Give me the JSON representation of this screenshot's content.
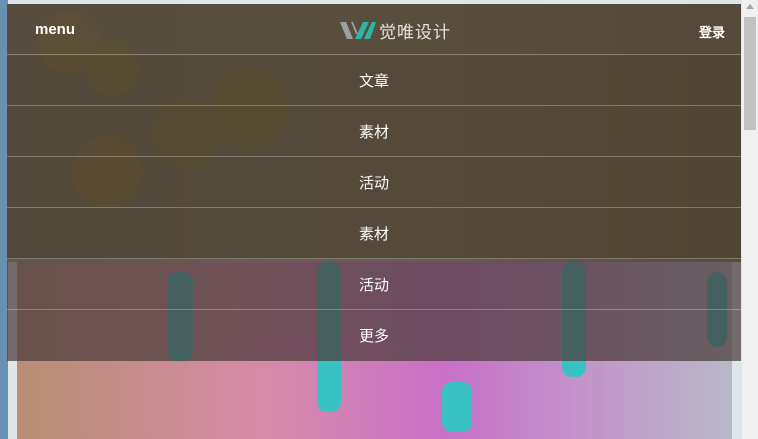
{
  "header": {
    "menu_label": "menu",
    "logo_text": "觉唯设计",
    "login_label": "登录"
  },
  "menu": {
    "items": [
      {
        "label": "文章"
      },
      {
        "label": "素材"
      },
      {
        "label": "活动"
      },
      {
        "label": "素材"
      },
      {
        "label": "活动"
      },
      {
        "label": "更多"
      }
    ]
  },
  "colors": {
    "header_bg": "#524637",
    "logo_v_left": "#9aa0a3",
    "logo_v_right": "#2bb7a8"
  },
  "icons": {
    "logo": "vj-logo-mark",
    "scroll_up": "triangle-up-arrow"
  }
}
